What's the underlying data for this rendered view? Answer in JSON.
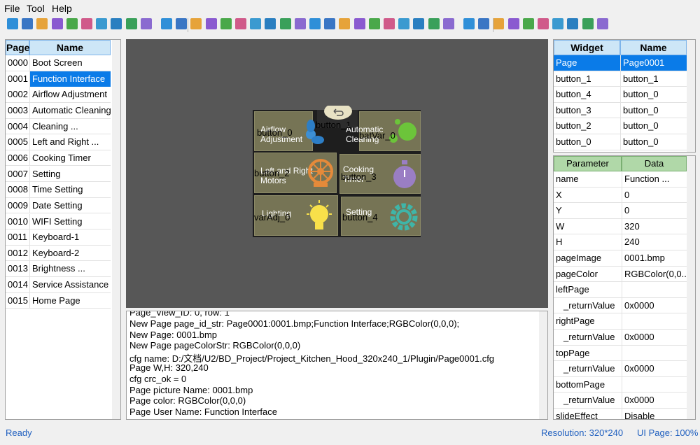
{
  "menu": [
    "File",
    "Tool",
    "Help"
  ],
  "toolbar_icons": [
    "search-icon",
    "page-list-icon",
    "page-icon",
    "grid-icon",
    "tree-icon",
    "palette-icon",
    "list-icon",
    "keyboard-icon",
    "keyboard-en-icon",
    "keyboard-kbk-icon",
    "text-icon",
    "button-icon",
    "number-icon",
    "window-icon",
    "clock-icon",
    "date-icon",
    "alarm-icon",
    "gif-icon",
    "qr-icon",
    "wav-icon",
    "slider-icon",
    "ring-icon",
    "bitmap-icon",
    "target-icon",
    "image-edit-icon",
    "image-icon",
    "pointer-icon",
    "gauge-icon",
    "video-icon",
    "record-icon",
    "align-left-icon",
    "align-right-icon",
    "align-top-icon",
    "align-bottom-icon",
    "same-width-icon",
    "same-height-icon",
    "same-size-icon",
    "distribute-h-icon",
    "distribute-v-icon",
    "zoom-icon"
  ],
  "page_list": {
    "headers": [
      "Page",
      "Name"
    ],
    "rows": [
      [
        "0000",
        "Boot Screen"
      ],
      [
        "0001",
        "Function Interface"
      ],
      [
        "0002",
        "Airflow Adjustment"
      ],
      [
        "0003",
        "Automatic Cleaning"
      ],
      [
        "0004",
        "Cleaning ..."
      ],
      [
        "0005",
        "Left and Right ..."
      ],
      [
        "0006",
        "Cooking Timer"
      ],
      [
        "0007",
        "Setting"
      ],
      [
        "0008",
        "Time Setting"
      ],
      [
        "0009",
        "Date Setting"
      ],
      [
        "0010",
        "WIFI Setting"
      ],
      [
        "0011",
        "Keyboard-1"
      ],
      [
        "0012",
        "Keyboard-2"
      ],
      [
        "0013",
        "Brightness ..."
      ],
      [
        "0014",
        "Service Assistance"
      ],
      [
        "0015",
        "Home Page"
      ]
    ],
    "selected": 1
  },
  "preview": {
    "tiles": [
      {
        "text": "Airflow Adjustment"
      },
      {
        "text": "Automatic Cleaning"
      },
      {
        "text": "Left and Right Motors"
      },
      {
        "text": "Cooking Timer"
      },
      {
        "text": "Lighting"
      },
      {
        "text": "Setting"
      }
    ],
    "labels": [
      "button_1",
      "button_0",
      "batVar_0",
      "button_2",
      "button_3",
      "varAdj_0",
      "button_4"
    ]
  },
  "log_lines": [
    "Page_View_ID: 0, row: 1",
    "New Page page_id_str: Page0001:0001.bmp;Function Interface;RGBColor(0,0,0);",
    "New Page: 0001.bmp",
    "New Page pageColorStr: RGBColor(0,0,0)",
    "cfg name: D:/文档/U2/BD_Project/Project_Kitchen_Hood_320x240_1/Plugin/Page0001.cfg",
    "Page W,H: 320,240",
    "cfg crc_ok = 0",
    "Page picture Name: 0001.bmp",
    "Page color: RGBColor(0,0,0)",
    "Page User Name: Function Interface"
  ],
  "widget_list": {
    "headers": [
      "Widget",
      "Name"
    ],
    "rows": [
      [
        "Page",
        "Page0001"
      ],
      [
        "button_1",
        "button_1"
      ],
      [
        "button_4",
        "button_0"
      ],
      [
        "button_3",
        "button_0"
      ],
      [
        "button_2",
        "button_0"
      ],
      [
        "button_0",
        "button_0"
      ]
    ],
    "selected": 0
  },
  "params": {
    "headers": [
      "Parameter",
      "Data"
    ],
    "rows": [
      [
        "name",
        "Function ..."
      ],
      [
        "X",
        "0"
      ],
      [
        "Y",
        "0"
      ],
      [
        "W",
        "320"
      ],
      [
        "H",
        "240"
      ],
      [
        "pageImage",
        "0001.bmp"
      ],
      [
        "pageColor",
        "RGBColor(0,0..."
      ],
      [
        "leftPage",
        ""
      ],
      [
        "_returnValue",
        "0x0000"
      ],
      [
        "rightPage",
        ""
      ],
      [
        "_returnValue",
        "0x0000"
      ],
      [
        "topPage",
        ""
      ],
      [
        "_returnValue",
        "0x0000"
      ],
      [
        "bottomPage",
        ""
      ],
      [
        "_returnValue",
        "0x0000"
      ],
      [
        "slideEffect",
        "Disable"
      ]
    ]
  },
  "status": {
    "left": "Ready",
    "resolution": "Resolution: 320*240",
    "ui_page": "UI Page: 100%"
  }
}
